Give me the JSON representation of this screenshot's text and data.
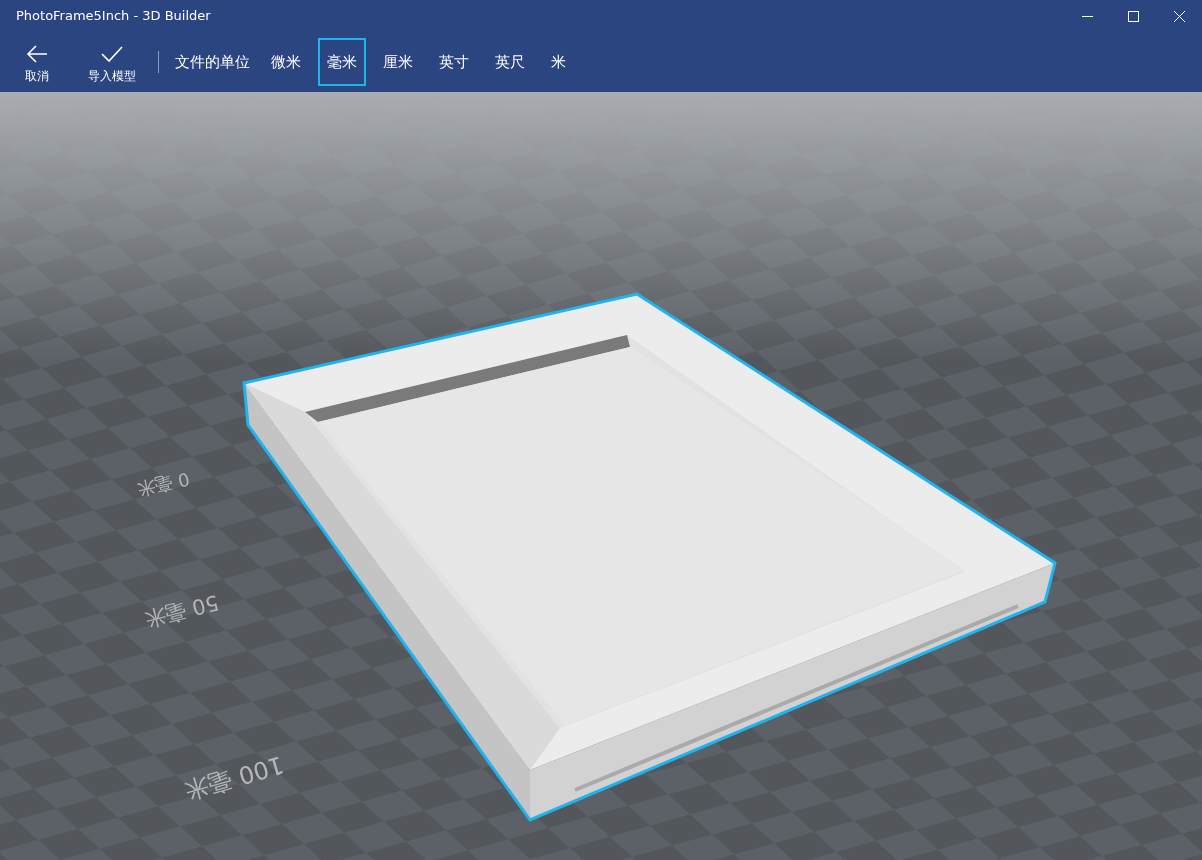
{
  "window": {
    "title": "PhotoFrame5Inch - 3D Builder"
  },
  "toolbar": {
    "actions": [
      {
        "kind": "back",
        "label": "取消"
      },
      {
        "kind": "check",
        "label": "导入模型"
      }
    ],
    "units_label": "文件的单位",
    "units": [
      {
        "label": "微米",
        "selected": false
      },
      {
        "label": "毫米",
        "selected": true
      },
      {
        "label": "厘米",
        "selected": false
      },
      {
        "label": "英寸",
        "selected": false
      },
      {
        "label": "英尺",
        "selected": false
      },
      {
        "label": "米",
        "selected": false
      }
    ]
  },
  "viewport": {
    "ruler_labels": [
      "0 毫米",
      "50 毫米",
      "100 毫米"
    ]
  }
}
